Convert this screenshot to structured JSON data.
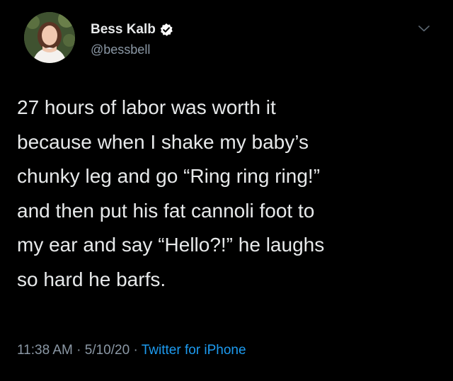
{
  "author": {
    "display_name": "Bess Kalb",
    "handle": "@bessbell",
    "verified_icon": "verified-badge-icon"
  },
  "tweet": {
    "lines": [
      "27 hours of labor was worth it",
      "because when I shake my baby’s",
      "chunky leg and go “Ring ring ring!”",
      "and then put his fat cannoli foot to",
      "my ear and say “Hello?!” he laughs",
      "so hard he barfs."
    ]
  },
  "meta": {
    "time": "11:38 AM",
    "separator_1": " · ",
    "date": "5/10/20",
    "separator_2": " · ",
    "source": "Twitter for iPhone"
  },
  "icons": {
    "menu": "chevron-down-icon",
    "avatar": "profile-photo"
  },
  "colors": {
    "background": "#000000",
    "text": "#e7e9ea",
    "secondary": "#8b98a5",
    "link": "#1d9bf0",
    "verified": "#ffffff"
  }
}
